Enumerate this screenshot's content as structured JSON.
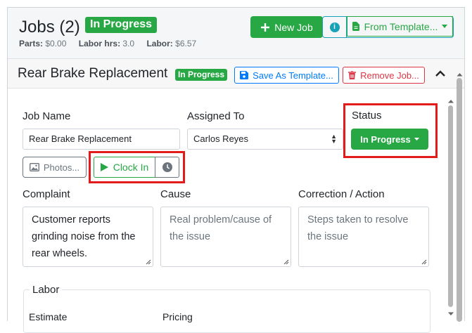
{
  "header": {
    "title": "Jobs (2)",
    "status_badge": "In Progress",
    "stats": {
      "parts_label": "Parts:",
      "parts_value": "$0.00",
      "labor_hrs_label": "Labor hrs:",
      "labor_hrs_value": "3.0",
      "labor_label": "Labor:",
      "labor_value": "$6.57"
    },
    "new_job_label": "New Job",
    "from_template_label": "From Template..."
  },
  "job": {
    "title": "Rear Brake Replacement",
    "status_badge": "In Progress",
    "save_template_label": "Save As Template...",
    "remove_job_label": "Remove Job...",
    "fields": {
      "job_name_label": "Job Name",
      "job_name_value": "Rear Brake Replacement",
      "assigned_to_label": "Assigned To",
      "assigned_to_value": "Carlos Reyes",
      "status_label": "Status",
      "status_value": "In Progress"
    },
    "photos_label": "Photos...",
    "clock_in_label": "Clock In",
    "complaint": {
      "label": "Complaint",
      "value": "Customer reports grinding noise from the rear wheels."
    },
    "cause": {
      "label": "Cause",
      "placeholder": "Real problem/cause of the issue"
    },
    "correction": {
      "label": "Correction / Action",
      "placeholder": "Steps taken to resolve the issue"
    },
    "labor": {
      "legend": "Labor",
      "estimate_label": "Estimate",
      "pricing_label": "Pricing"
    }
  },
  "colors": {
    "success": "#28a745",
    "primary": "#007bff",
    "danger": "#dc3545",
    "info": "#17a2b8",
    "highlight": "#e31b1b"
  }
}
